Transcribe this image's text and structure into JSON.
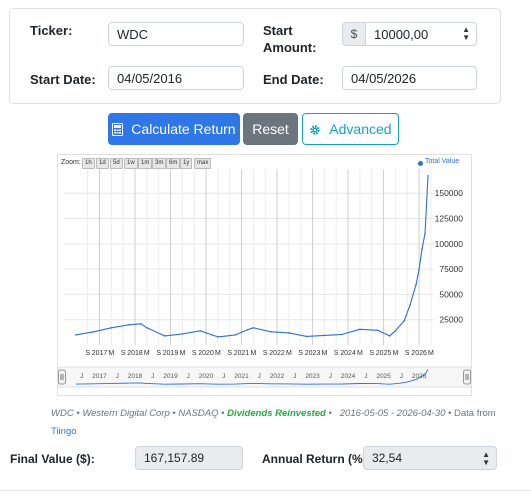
{
  "form": {
    "ticker_label": "Ticker:",
    "ticker_value": "WDC",
    "start_amount_label_line1": "Start",
    "start_amount_label_line2": "Amount:",
    "currency_symbol": "$",
    "start_amount_value": "10000,00",
    "start_date_label": "Start Date:",
    "start_date_value": "04/05/2016",
    "end_date_label": "End Date:",
    "end_date_value": "04/05/2026"
  },
  "buttons": {
    "calculate": "Calculate Return",
    "reset": "Reset",
    "advanced": "Advanced"
  },
  "chart": {
    "zoom_label": "Zoom:",
    "zoom_options": [
      "1h",
      "1d",
      "5d",
      "1w",
      "1m",
      "3m",
      "6m",
      "1y",
      "max"
    ],
    "legend": "Total Value",
    "y_ticks": [
      "25000",
      "50000",
      "75000",
      "100000",
      "125000",
      "150000"
    ],
    "x_ticks": [
      "S",
      "2017",
      "M",
      "S",
      "2018",
      "M",
      "S",
      "2019",
      "M",
      "S",
      "2020",
      "M",
      "S",
      "2021",
      "M",
      "S",
      "2022",
      "M",
      "S",
      "2023",
      "M",
      "S",
      "2024",
      "M",
      "S",
      "2025",
      "M",
      "S",
      "2026",
      "M"
    ],
    "navigator_ticks": [
      "J",
      "2017",
      "J",
      "2018",
      "J",
      "2019",
      "J",
      "2020",
      "J",
      "2021",
      "J",
      "2022",
      "J",
      "2023",
      "J",
      "2024",
      "J",
      "2025",
      "J",
      "2026"
    ],
    "line_color": "#2f6fd6"
  },
  "chart_data": {
    "type": "line",
    "title": "",
    "xlabel": "",
    "ylabel": "",
    "series": [
      {
        "name": "Total Value",
        "x": [
          "2016-05",
          "2016-11",
          "2017-05",
          "2017-11",
          "2018-03",
          "2018-05",
          "2018-11",
          "2019-05",
          "2019-11",
          "2020-03",
          "2020-05",
          "2020-11",
          "2021-03",
          "2021-05",
          "2021-11",
          "2022-05",
          "2022-11",
          "2023-05",
          "2023-11",
          "2024-05",
          "2024-11",
          "2025-03",
          "2025-05",
          "2025-08",
          "2025-10",
          "2025-12",
          "2026-01",
          "2026-02",
          "2026-03",
          "2026-04"
        ],
        "values": [
          10000,
          13000,
          17000,
          20000,
          21000,
          17000,
          9000,
          11000,
          14000,
          10000,
          8000,
          10000,
          15000,
          17000,
          13000,
          12000,
          8500,
          9500,
          10500,
          15500,
          14500,
          9000,
          14000,
          24000,
          40000,
          60000,
          75000,
          95000,
          110000,
          167158
        ]
      }
    ],
    "ylim": [
      0,
      170000
    ],
    "y_ticks": [
      25000,
      50000,
      75000,
      100000,
      125000,
      150000
    ],
    "grid": true,
    "legend_placement": "top-right"
  },
  "credit": {
    "ticker": "WDC",
    "company": "Western Digital Corp",
    "exchange": "NASDAQ",
    "dividends": "Dividends Reinvested",
    "date_range": "2016-05-05 - 2026-04-30",
    "data_from": "Data from",
    "source": "Tiingo"
  },
  "results": {
    "final_value_label": "Final Value ($):",
    "final_value": "167,157.89",
    "annual_return_label": "Annual Return (%):",
    "annual_return": "32,54"
  }
}
